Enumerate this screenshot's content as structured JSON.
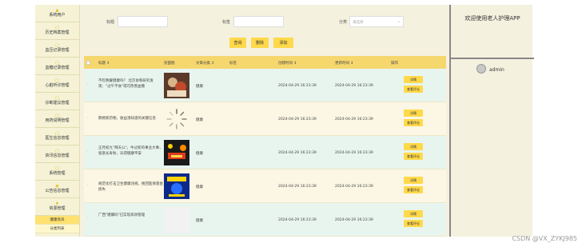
{
  "sidebar": {
    "items": [
      {
        "label": "系统用户"
      },
      {
        "label": "历史档案管理"
      },
      {
        "label": "血压记录管理"
      },
      {
        "label": "血糖记录管理"
      },
      {
        "label": "心脏听诊管理"
      },
      {
        "label": "诊断建议管理"
      },
      {
        "label": "用药说明管理"
      },
      {
        "label": "医生信息管理"
      },
      {
        "label": "资讯信息管理"
      },
      {
        "label": "系统管理"
      },
      {
        "label": "公告信息管理"
      },
      {
        "label": "资源管理"
      }
    ],
    "sub_items": [
      {
        "label": "健康资讯",
        "active": true
      },
      {
        "label": "分类列表",
        "active": false
      }
    ]
  },
  "filters": {
    "title_label": "标题",
    "tag_label": "标签",
    "category_label": "分类",
    "category_placeholder": "请选择"
  },
  "buttons": {
    "search": "查询",
    "delete": "删除",
    "add": "添加"
  },
  "table": {
    "headers": [
      "标题 ↕",
      "封面图",
      "文章分类 ↕",
      "标签",
      "创建时间 ↕",
      "更新时间 ↕",
      "操作"
    ],
    "rows": [
      {
        "title": "不吃晚餐健康吗？ 北京协和研究发现：\"过午不食\"或可改善血糖",
        "category": "健康",
        "created": "2024-04-29 16:23:39",
        "updated": "2024-04-29 16:23:39",
        "actions": [
          "详情",
          "查看评论"
        ],
        "thumb": "photo"
      },
      {
        "title": "肺癌新药物，收益须知道的关键信息",
        "category": "健康",
        "created": "2024-04-29 16:23:39",
        "updated": "2024-04-29 16:23:39",
        "actions": [
          "详情",
          "查看评论"
        ],
        "thumb": "loading"
      },
      {
        "title": "正月初九\"拜天公\"，牛过新的事业大事，留意长寿秋，乐得健康平安",
        "category": "健康",
        "created": "2024-04-29 16:23:39",
        "updated": "2024-04-29 16:23:39",
        "actions": [
          "详情",
          "查看评论"
        ],
        "thumb": "festival"
      },
      {
        "title": "规范化打击卫生健康违规，挽回医保基金损失",
        "category": "健康",
        "created": "2024-04-29 16:23:39",
        "updated": "2024-04-29 16:23:39",
        "actions": [
          "详情",
          "查看评论"
        ],
        "thumb": "poster"
      },
      {
        "title": "广西\"健康码\"已实现高效管理",
        "category": "健康",
        "created": "2024-04-29 16:23:39",
        "updated": "2024-04-29 16:23:39",
        "actions": [
          "详情",
          "查看评论"
        ],
        "thumb": "blank"
      }
    ]
  },
  "right_panel": {
    "welcome": "欢迎使用老人护理APP",
    "user": "admin"
  },
  "watermark": "CSDN @VX_ZYKJ985",
  "colors": {
    "accent": "#ffd94a",
    "header": "#f5d76e",
    "background": "#f4f1df"
  }
}
